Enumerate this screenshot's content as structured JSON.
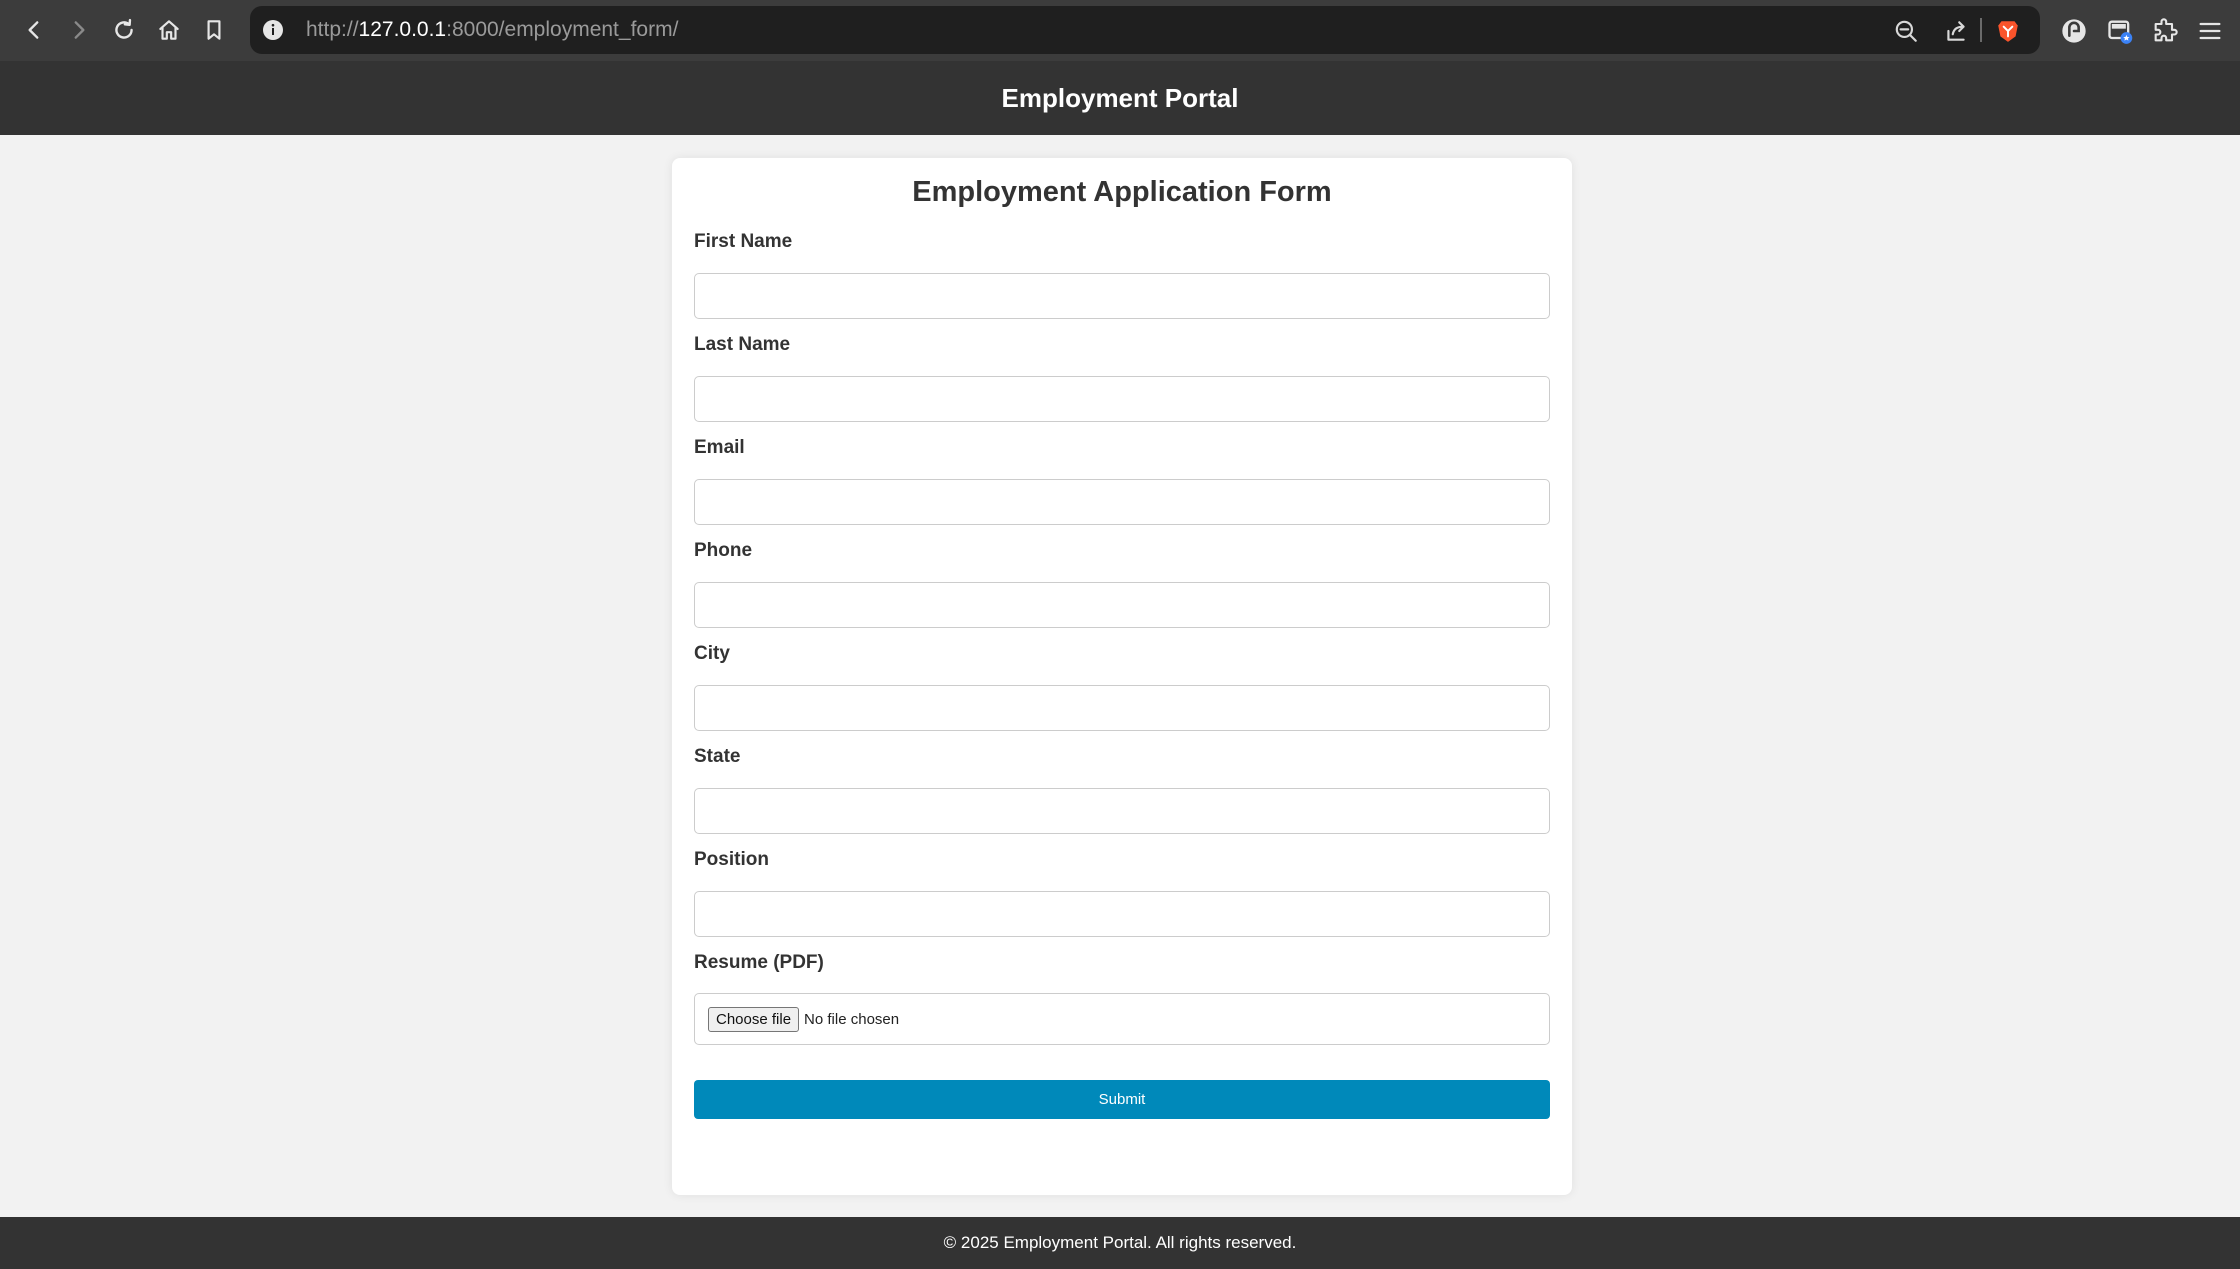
{
  "browser": {
    "url_scheme": "http://",
    "url_host": "127.0.0.1",
    "url_rest": ":8000/employment_form/",
    "icons": [
      "back-icon",
      "forward-icon",
      "reload-icon",
      "home-icon",
      "bookmark-icon",
      "info-icon",
      "zoom-out-icon",
      "share-icon",
      "brave-shield-icon",
      "leo-icon",
      "wallet-icon",
      "extensions-icon",
      "menu-icon"
    ]
  },
  "header": {
    "title": "Employment Portal"
  },
  "form": {
    "title": "Employment Application Form",
    "fields": [
      {
        "label": "First Name",
        "value": ""
      },
      {
        "label": "Last Name",
        "value": ""
      },
      {
        "label": "Email",
        "value": ""
      },
      {
        "label": "Phone",
        "value": ""
      },
      {
        "label": "City",
        "value": ""
      },
      {
        "label": "State",
        "value": ""
      },
      {
        "label": "Position",
        "value": ""
      }
    ],
    "resume": {
      "label": "Resume (PDF)",
      "button_label": "Choose file",
      "status": "No file chosen"
    },
    "submit_label": "Submit"
  },
  "footer": {
    "text": "© 2025 Employment Portal. All rights reserved."
  },
  "colors": {
    "header_bg": "#333333",
    "page_bg": "#f2f2f2",
    "submit_bg": "#0089ba"
  }
}
